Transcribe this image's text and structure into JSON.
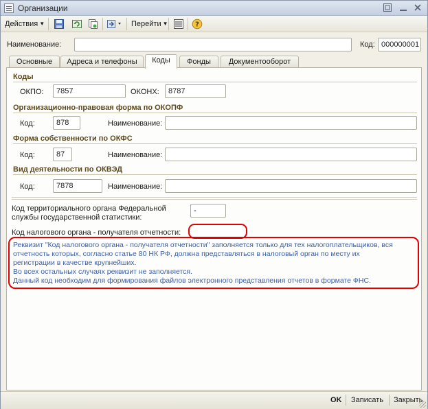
{
  "window": {
    "title": "Организации"
  },
  "toolbar": {
    "actions_label": "Действия",
    "goto_label": "Перейти"
  },
  "header": {
    "name_label": "Наименование:",
    "name_value": "",
    "code_label": "Код:",
    "code_value": "000000001"
  },
  "tabs": [
    {
      "label": "Основные"
    },
    {
      "label": "Адреса и телефоны"
    },
    {
      "label": "Коды"
    },
    {
      "label": "Фонды"
    },
    {
      "label": "Документооборот"
    }
  ],
  "codes": {
    "section_title": "Коды",
    "okpo_label": "ОКПО:",
    "okpo_value": "7857",
    "okonh_label": "ОКОНХ:",
    "okonh_value": "8787"
  },
  "okopf": {
    "section_title": "Организационно-правовая форма по ОКОПФ",
    "code_label": "Код:",
    "code_value": "878",
    "name_label": "Наименование:",
    "name_value": ""
  },
  "okfs": {
    "section_title": "Форма собственности по ОКФС",
    "code_label": "Код:",
    "code_value": "87",
    "name_label": "Наименование:",
    "name_value": ""
  },
  "okved": {
    "section_title": "Вид деятельности по ОКВЭД",
    "code_label": "Код:",
    "code_value": "7878",
    "name_label": "Наименование:",
    "name_value": ""
  },
  "territorial": {
    "label_line1": "Код территориального органа Федеральной",
    "label_line2": "службы государственной статистики:",
    "value": "-"
  },
  "tax": {
    "label": "Код налогового органа - получателя отчетности:",
    "value": ""
  },
  "info": {
    "line1": "Реквизит \"Код налогового органа - получателя отчетности\" заполняется только для тех налогоплательщиков, вся",
    "line2": "отчетность которых, согласно статье 80 НК РФ, должна представляться в налоговый орган по месту их",
    "line3": "регистрации в качестве крупнейших.",
    "line4": "Во всех остальных случаях реквизит не заполняется.",
    "line5": "Данный код необходим для формирования файлов электронного представления отчетов в формате ФНС."
  },
  "bottom": {
    "ok_label": "OK",
    "save_label": "Записать",
    "close_label": "Закрыть"
  },
  "colors": {
    "info_text": "#3a5fa8",
    "highlight": "#e00000",
    "section_title": "#5c4a1e"
  }
}
